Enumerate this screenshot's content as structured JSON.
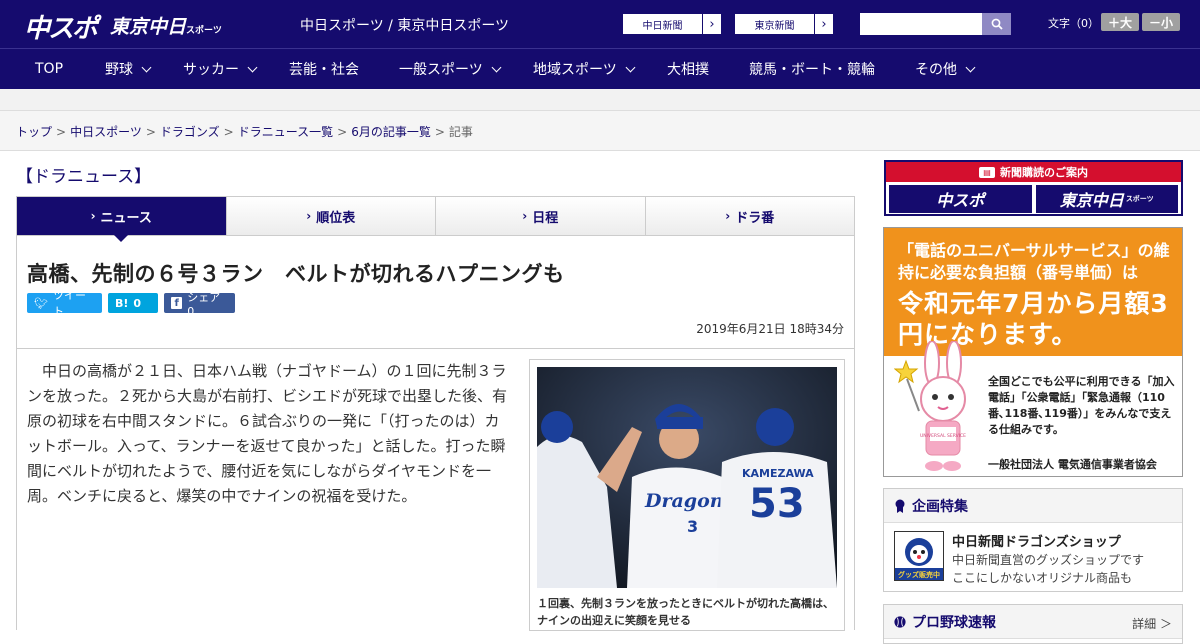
{
  "header": {
    "logo_main": "中スポ",
    "logo_tokyo": "東京中日",
    "logo_tokyo_sub": "スポーツ",
    "site_title": "中日スポーツ / 東京中日スポーツ",
    "buttons": [
      {
        "label": "中日新聞"
      },
      {
        "label": "東京新聞"
      }
    ],
    "search_placeholder": "",
    "font_size_label": "文字（0）",
    "font_up": "＋大",
    "font_down": "－小"
  },
  "nav": {
    "items": [
      {
        "label": "TOP",
        "dropdown": false
      },
      {
        "label": "野球",
        "dropdown": true
      },
      {
        "label": "サッカー",
        "dropdown": true
      },
      {
        "label": "芸能・社会",
        "dropdown": false
      },
      {
        "label": "一般スポーツ",
        "dropdown": true
      },
      {
        "label": "地域スポーツ",
        "dropdown": true
      },
      {
        "label": "大相撲",
        "dropdown": false
      },
      {
        "label": "競馬・ボート・競輪",
        "dropdown": false
      },
      {
        "label": "その他",
        "dropdown": true
      }
    ]
  },
  "breadcrumb": {
    "items": [
      "トップ",
      "中日スポーツ",
      "ドラゴンズ",
      "ドラニュース一覧",
      "6月の記事一覧"
    ],
    "current": "記事",
    "separator": ">"
  },
  "section_title": "【ドラニュース】",
  "tabs": [
    {
      "label": "ニュース",
      "active": true
    },
    {
      "label": "順位表",
      "active": false
    },
    {
      "label": "日程",
      "active": false
    },
    {
      "label": "ドラ番",
      "active": false
    }
  ],
  "article": {
    "headline": "高橋、先制の６号３ラン　ベルトが切れるハプニングも",
    "share": {
      "tweet": "ツイート",
      "hatena_count": "0",
      "facebook": "シェア 0"
    },
    "date": "2019年6月21日 18時34分",
    "body": "　中日の高橋が２１日、日本ハム戦（ナゴヤドーム）の１回に先制３ランを放った。２死から大島が右前打、ビシエドが死球で出塁した後、有原の初球を右中間スタンドに。６試合ぶりの一発に「（打ったのは）カットボール。入って、ランナーを返せて良かった」と話した。打った瞬間にベルトが切れたようで、腰付近を気にしながらダイヤモンドを一周。ベンチに戻ると、爆笑の中でナインの祝福を受けた。",
    "photo": {
      "jersey_text": "Dragons",
      "jersey_number": "3",
      "back_name": "KAMEZAWA",
      "back_number": "53",
      "caption": "１回裏、先制３ランを放ったときにベルトが切れた高橋は、ナインの出迎えに笑顔を見せる"
    }
  },
  "sidebar": {
    "subscribe": {
      "head": "新聞購読のご案内",
      "logo1": "中スポ",
      "logo2": "東京中日",
      "logo2_sub": "スポーツ"
    },
    "ad": {
      "line1": "「電話のユニバーサルサービス」の維持に必要な負担額（番号単価）は",
      "line2": "令和元年7月から月額3円になります。",
      "desc": "全国どこでも公平に利用できる「加入電話」「公衆電話」「緊急通報（110番､118番､119番）」をみんなで支える仕組みです。",
      "org": "一般社団法人 電気通信事業者協会",
      "mascot_badge": "UNIVERSAL SERVICE"
    },
    "feature": {
      "head": "企画特集",
      "title": "中日新聞ドラゴンズショップ",
      "desc1": "中日新聞直営のグッズショップです",
      "desc2": "ここにしかないオリジナル商品も",
      "img_label": "グッズ販売中"
    },
    "pro_baseball": {
      "head": "プロ野球速報",
      "detail": "詳細 ＞"
    }
  },
  "colors": {
    "brand": "#150b6e",
    "accent_red": "#d40f2e",
    "ad_orange": "#f0921c"
  }
}
